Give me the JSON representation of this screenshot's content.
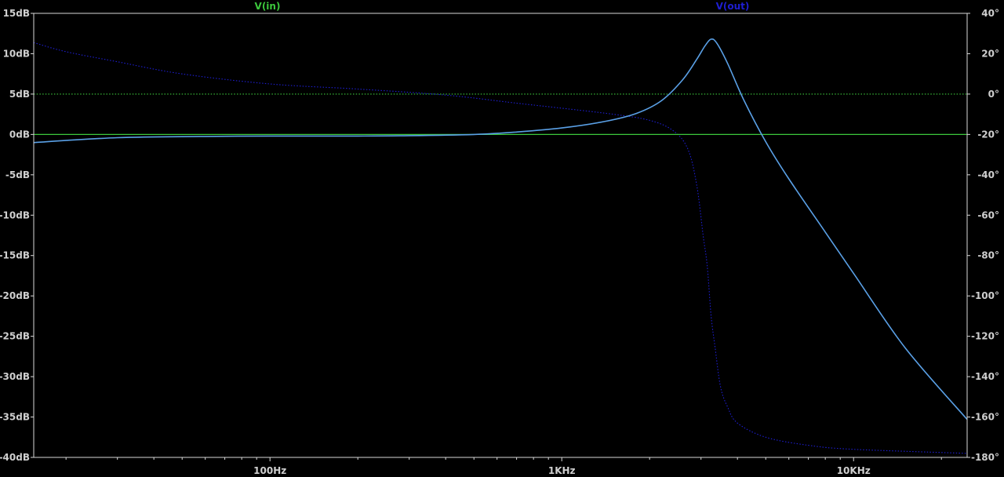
{
  "chart_data": {
    "type": "line",
    "x_scale": "log",
    "xlim": [
      15.5,
      24500
    ],
    "ylim_left": [
      -40,
      15
    ],
    "ylim_right": [
      -180,
      40
    ],
    "x_ticks": [
      {
        "value": 100,
        "label": "100Hz"
      },
      {
        "value": 1000,
        "label": "1KHz"
      },
      {
        "value": 10000,
        "label": "10KHz"
      }
    ],
    "y_ticks_left": [
      {
        "value": 15,
        "label": "15dB"
      },
      {
        "value": 10,
        "label": "10dB"
      },
      {
        "value": 5,
        "label": "5dB"
      },
      {
        "value": 0,
        "label": "0dB"
      },
      {
        "value": -5,
        "label": "-5dB"
      },
      {
        "value": -10,
        "label": "-10dB"
      },
      {
        "value": -15,
        "label": "-15dB"
      },
      {
        "value": -20,
        "label": "-20dB"
      },
      {
        "value": -25,
        "label": "-25dB"
      },
      {
        "value": -30,
        "label": "-30dB"
      },
      {
        "value": -35,
        "label": "-35dB"
      },
      {
        "value": -40,
        "label": "-40dB"
      }
    ],
    "y_ticks_right": [
      {
        "value": 40,
        "label": "40°"
      },
      {
        "value": 20,
        "label": "20°"
      },
      {
        "value": 0,
        "label": "0°"
      },
      {
        "value": -20,
        "label": "-20°"
      },
      {
        "value": -40,
        "label": "-40°"
      },
      {
        "value": -60,
        "label": "-60°"
      },
      {
        "value": -80,
        "label": "-80°"
      },
      {
        "value": -100,
        "label": "-100°"
      },
      {
        "value": -120,
        "label": "-120°"
      },
      {
        "value": -140,
        "label": "-140°"
      },
      {
        "value": -160,
        "label": "-160°"
      },
      {
        "value": -180,
        "label": "-180°"
      }
    ],
    "grid": false,
    "series": [
      {
        "name": "V(in)",
        "color": "#3cc83c",
        "magnitude_db": [
          [
            15.5,
            0
          ],
          [
            24500,
            0
          ]
        ],
        "phase_deg": [
          [
            15.5,
            0
          ],
          [
            24500,
            0
          ]
        ]
      },
      {
        "name": "V(out)",
        "color": "#1e1ed2",
        "magnitude_db": [
          [
            15.5,
            -1.0
          ],
          [
            30,
            -0.4
          ],
          [
            60,
            -0.25
          ],
          [
            100,
            -0.2
          ],
          [
            200,
            -0.2
          ],
          [
            300,
            -0.15
          ],
          [
            500,
            0
          ],
          [
            700,
            0.3
          ],
          [
            1000,
            0.8
          ],
          [
            1400,
            1.6
          ],
          [
            1800,
            2.6
          ],
          [
            2200,
            4.2
          ],
          [
            2600,
            6.8
          ],
          [
            2900,
            9.3
          ],
          [
            3100,
            11.0
          ],
          [
            3250,
            11.8
          ],
          [
            3400,
            11.3
          ],
          [
            3700,
            8.8
          ],
          [
            4200,
            4.3
          ],
          [
            5000,
            -0.9
          ],
          [
            6000,
            -5.5
          ],
          [
            8000,
            -12.1
          ],
          [
            10000,
            -17.2
          ],
          [
            15000,
            -26.4
          ],
          [
            24500,
            -35.3
          ]
        ],
        "phase_deg": [
          [
            15.5,
            25.5
          ],
          [
            20,
            21.0
          ],
          [
            30,
            16.0
          ],
          [
            50,
            10.0
          ],
          [
            100,
            5.0
          ],
          [
            200,
            2.5
          ],
          [
            400,
            -0.5
          ],
          [
            700,
            -4.5
          ],
          [
            1000,
            -7.0
          ],
          [
            1500,
            -10.0
          ],
          [
            2000,
            -13.0
          ],
          [
            2400,
            -18.0
          ],
          [
            2700,
            -27.0
          ],
          [
            2900,
            -45.0
          ],
          [
            3050,
            -70.0
          ],
          [
            3150,
            -85.0
          ],
          [
            3250,
            -110.0
          ],
          [
            3350,
            -125.0
          ],
          [
            3500,
            -145.0
          ],
          [
            3700,
            -155.0
          ],
          [
            4000,
            -163.0
          ],
          [
            5000,
            -170.0
          ],
          [
            7000,
            -174.0
          ],
          [
            10000,
            -176.0
          ],
          [
            24500,
            -178.0
          ]
        ]
      }
    ]
  }
}
